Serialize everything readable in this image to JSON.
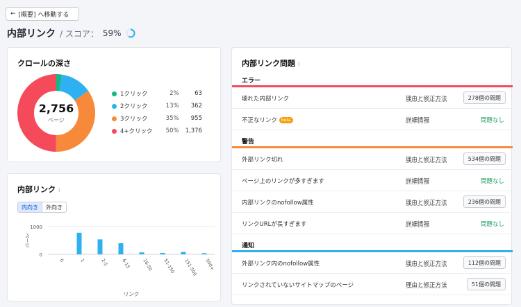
{
  "back_button": {
    "label": "[概要] へ移動する"
  },
  "header": {
    "title": "内部リンク",
    "score_label": "/ スコア：",
    "score_value": "59%",
    "score_fraction": 0.59
  },
  "depth_card": {
    "title": "クロールの深さ",
    "total": "2,756",
    "unit": "ページ",
    "legend": [
      {
        "label": "1クリック",
        "pct": "2%",
        "count": "63",
        "color": "#12b886"
      },
      {
        "label": "2クリック",
        "pct": "13%",
        "count": "362",
        "color": "#2fb0f0"
      },
      {
        "label": "3クリック",
        "pct": "35%",
        "count": "955",
        "color": "#f7893a"
      },
      {
        "label": "4+クリック",
        "pct": "50%",
        "count": "1,376",
        "color": "#f44a59"
      }
    ]
  },
  "links_card": {
    "title": "内部リンク",
    "info": "i",
    "toggle": {
      "inbound": "内向き",
      "outbound": "外向き"
    }
  },
  "chart_data": {
    "type": "bar",
    "categories": [
      "0",
      "1",
      "2-5",
      "6-15",
      "16-50",
      "51-150",
      "151-500",
      "500+"
    ],
    "values": [
      0,
      780,
      540,
      400,
      70,
      50,
      85,
      40
    ],
    "xlabel": "リンク",
    "ylabel": "ページ",
    "yticks": [
      "1000",
      "0"
    ],
    "ylim": [
      0,
      1000
    ],
    "color": "#2fb0f0"
  },
  "issues_card": {
    "title": "内部リンク問題",
    "info": "i",
    "sections": [
      {
        "label": "エラー",
        "color": "#f44a59",
        "rows": [
          {
            "name": "壊れた内部リンク",
            "link": "理由と修正方法",
            "count": "278個の問題"
          },
          {
            "name": "不正なリンク",
            "beta": "beta",
            "link": "詳細情報",
            "status": "問題なし"
          }
        ]
      },
      {
        "label": "警告",
        "color": "#f7893a",
        "rows": [
          {
            "name": "外部リンク切れ",
            "link": "理由と修正方法",
            "count": "534個の問題"
          },
          {
            "name": "ページ上のリンクが多すぎます",
            "link": "詳細情報",
            "status": "問題なし"
          },
          {
            "name": "内部リンクのnofollow属性",
            "link": "理由と修正方法",
            "count": "236個の問題"
          },
          {
            "name": "リンクURLが長すぎます",
            "link": "詳細情報",
            "status": "問題なし"
          }
        ]
      },
      {
        "label": "通知",
        "color": "#2fb0f0",
        "rows": [
          {
            "name": "外部リンク内のnofollow属性",
            "link": "理由と修正方法",
            "count": "112個の問題"
          },
          {
            "name": "リンクされていないサイトマップのページ",
            "link": "理由と修正方法",
            "count": "51個の問題"
          }
        ]
      }
    ]
  }
}
